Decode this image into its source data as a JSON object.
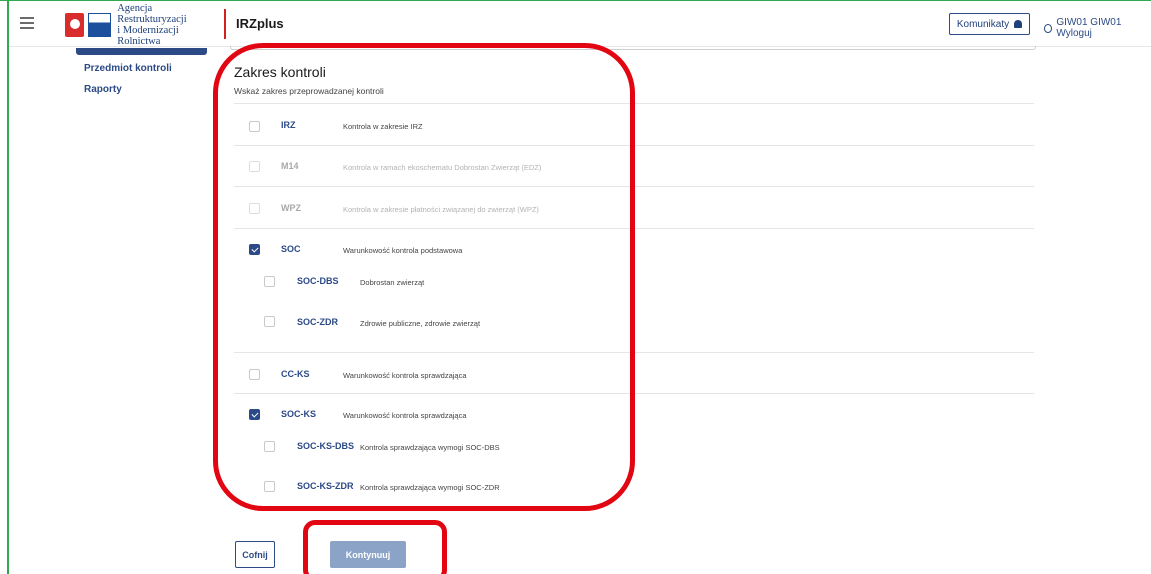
{
  "header": {
    "logo_line1": "Agencja Restrukturyzacji",
    "logo_line2": "i Modernizacji Rolnictwa",
    "app_name": "IRZplus",
    "notifications_label": "Komunikaty",
    "user_label": "GIW01 GIW01 Wyloguj",
    "icons": {
      "menu": "hamburger-icon",
      "bell": "bell-icon",
      "user": "user-icon"
    }
  },
  "sidebar": {
    "items": [
      {
        "label": "Przedmiot kontroli"
      },
      {
        "label": "Raporty"
      }
    ]
  },
  "section": {
    "title": "Zakres kontroli",
    "subtitle": "Wskaż zakres przeprowadzanej kontroli"
  },
  "scope_items": [
    {
      "code": "IRZ",
      "description": "Kontrola w zakresie IRZ",
      "checked": false,
      "enabled": true
    },
    {
      "code": "M14",
      "description": "Kontrola w ramach ekoschematu Dobrostan Zwierząt (EDZ)",
      "checked": false,
      "enabled": false
    },
    {
      "code": "WPZ",
      "description": "Kontrola w zakresie płatności związanej do zwierząt (WPZ)",
      "checked": false,
      "enabled": false
    },
    {
      "code": "SOC",
      "description": "Warunkowość kontrola podstawowa",
      "checked": true,
      "enabled": true,
      "children": [
        {
          "code": "SOC-DBS",
          "description": "Dobrostan zwierząt",
          "checked": false
        },
        {
          "code": "SOC-ZDR",
          "description": "Zdrowie publiczne, zdrowie zwierząt",
          "checked": false
        }
      ]
    },
    {
      "code": "CC-KS",
      "description": "Warunkowość kontrola sprawdzająca",
      "checked": false,
      "enabled": true
    },
    {
      "code": "SOC-KS",
      "description": "Warunkowość kontrola sprawdzająca",
      "checked": true,
      "enabled": true,
      "children": [
        {
          "code": "SOC-KS-DBS",
          "description": "Kontrola sprawdzająca wymogi SOC-DBS",
          "checked": false
        },
        {
          "code": "SOC-KS-ZDR",
          "description": "Kontrola sprawdzająca wymogi SOC-ZDR",
          "checked": false
        }
      ]
    }
  ],
  "actions": {
    "back_label": "Cofnij",
    "continue_label": "Kontynuuj"
  },
  "colors": {
    "primary": "#2b4a86",
    "highlight": "#e20613",
    "continue_disabled": "#8aa3c7"
  }
}
